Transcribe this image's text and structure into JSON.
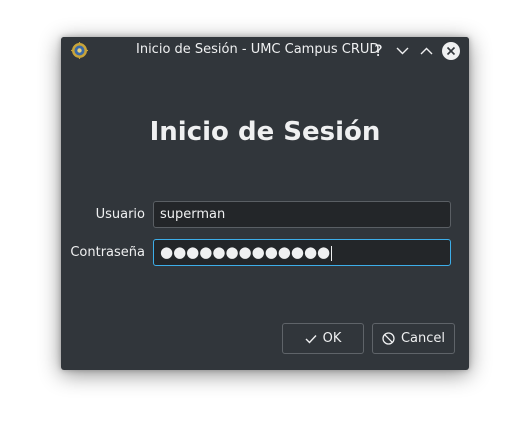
{
  "window": {
    "title": "Inicio de Sesión - UMC Campus CRUD",
    "help_glyph": "?",
    "icons": [
      "app-logo-icon",
      "help-icon",
      "minimize-icon",
      "maximize-icon",
      "close-icon"
    ]
  },
  "form": {
    "heading": "Inicio de Sesión",
    "username_label": "Usuario",
    "username_value": "superman",
    "password_label": "Contraseña",
    "password_mask": "●●●●●●●●●●●●●"
  },
  "buttons": {
    "ok_label": "OK",
    "cancel_label": "Cancel"
  },
  "colors": {
    "window_bg": "#31363b",
    "text": "#eff0f1",
    "field_bg": "#232629",
    "focus_accent": "#3daee9"
  }
}
